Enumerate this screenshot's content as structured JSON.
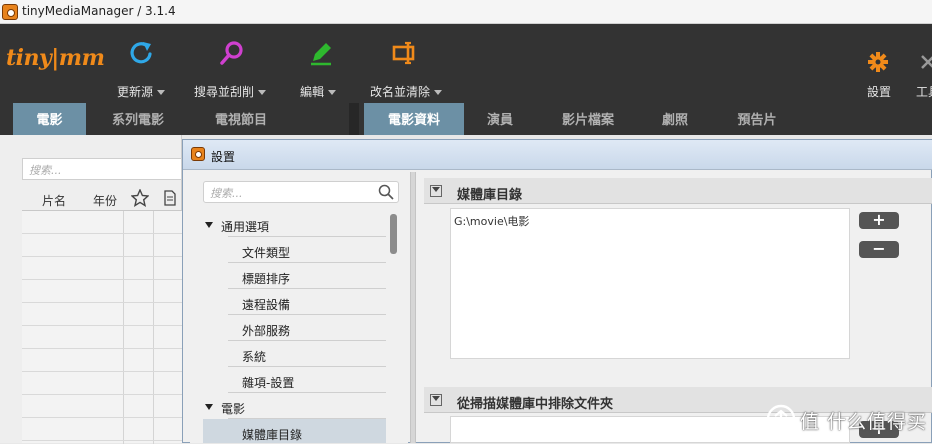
{
  "window": {
    "title": "tinyMediaManager / 3.1.4"
  },
  "toolbar": {
    "logo": "tiny|mm",
    "update_sources": "更新源",
    "search_scrape": "搜尋並刮削",
    "edit": "編輯",
    "rename_clean": "改名並清除",
    "settings": "設置",
    "tools": "工具"
  },
  "left_tabs": [
    "電影",
    "系列電影",
    "電視節目"
  ],
  "right_tabs": [
    "電影資料",
    "演員",
    "影片檔案",
    "劇照",
    "預告片"
  ],
  "movie_list": {
    "search_placeholder": "搜索...",
    "col_name": "片名",
    "col_year": "年份"
  },
  "dialog": {
    "title": "設置",
    "search_placeholder": "搜索...",
    "tree": {
      "general": "通用選項",
      "file_types": "文件類型",
      "title_sort": "標題排序",
      "remote_devices": "遠程設備",
      "external_services": "外部服務",
      "system": "系統",
      "misc": "雜項-設置",
      "movies": "電影",
      "media_library_dirs": "媒體庫目錄"
    },
    "sections": {
      "library_dirs": "媒體庫目錄",
      "exclude_folders": "從掃描媒體庫中排除文件夾"
    },
    "library_paths": [
      "G:\\movie\\电影"
    ],
    "add_label": "+",
    "remove_label": "−"
  },
  "watermark": {
    "text": "值 什么值得买"
  },
  "colors": {
    "accent": "#f08a1a",
    "toolbar_bg": "#333333",
    "active_tab": "#6c90a5"
  }
}
